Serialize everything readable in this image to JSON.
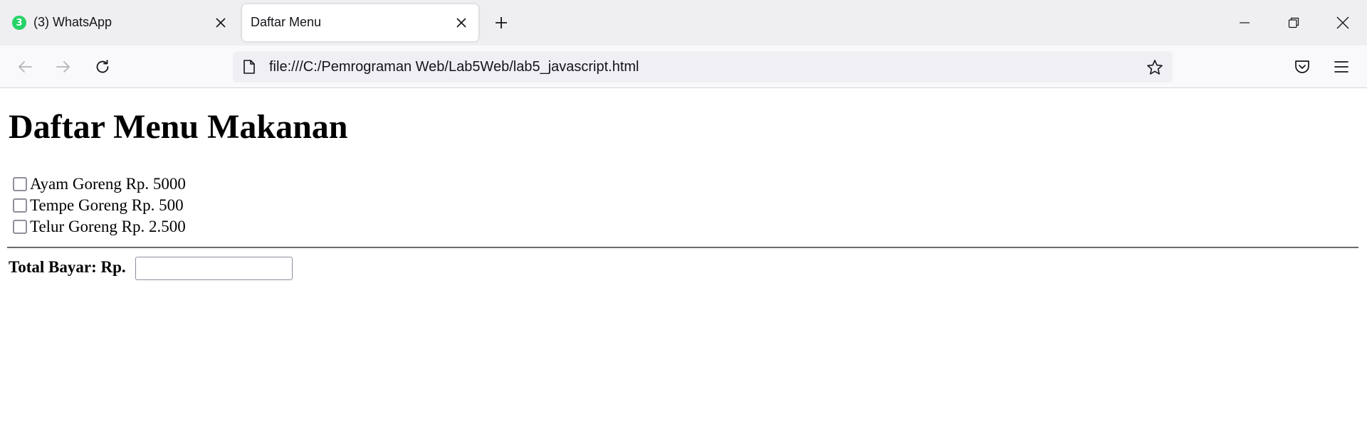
{
  "browser": {
    "tabs": [
      {
        "title": "(3) WhatsApp",
        "badge": "3",
        "active": false
      },
      {
        "title": "Daftar Menu",
        "active": true
      }
    ],
    "address": "file:///C:/Pemrograman Web/Lab5Web/lab5_javascript.html",
    "icons": {
      "back": "arrow-left-icon",
      "forward": "arrow-right-icon",
      "reload": "reload-icon",
      "page": "page-icon",
      "bookmark": "star-icon",
      "pocket": "pocket-icon",
      "menu": "hamburger-icon",
      "minimize": "minimize-icon",
      "restore": "restore-icon",
      "close": "close-icon",
      "new_tab": "plus-icon"
    },
    "colors": {
      "tabstrip_bg": "#efeef1",
      "toolbar_bg": "#f9f9fb",
      "urlbar_bg": "#f0f0f4",
      "whatsapp_green": "#25d366"
    }
  },
  "page": {
    "heading": "Daftar Menu Makanan",
    "menu_items": [
      {
        "label": "Ayam Goreng Rp. 5000",
        "checked": false
      },
      {
        "label": "Tempe Goreng Rp. 500",
        "checked": false
      },
      {
        "label": "Telur Goreng Rp. 2.500",
        "checked": false
      }
    ],
    "total_label": "Total Bayar: Rp.",
    "total_value": ""
  }
}
